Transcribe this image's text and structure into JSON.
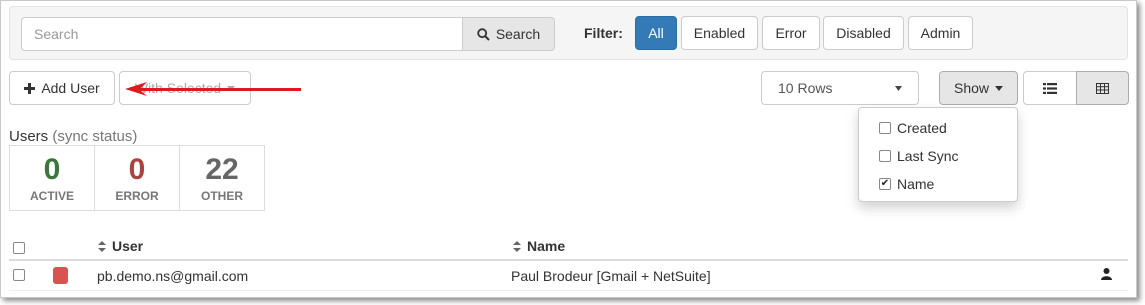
{
  "search": {
    "placeholder": "Search",
    "button_label": "Search",
    "button_icon": "search-icon"
  },
  "filter": {
    "label": "Filter:",
    "buttons": [
      {
        "label": "All",
        "active": true
      },
      {
        "label": "Enabled",
        "active": false
      },
      {
        "label": "Error",
        "active": false
      },
      {
        "label": "Disabled",
        "active": false
      },
      {
        "label": "Admin",
        "active": false
      }
    ]
  },
  "toolbar": {
    "add_user_label": "Add User",
    "with_selected_label": "With Selected",
    "rows_select_value": "10 Rows",
    "show_label": "Show",
    "view_list_icon": "list-icon",
    "view_grid_icon": "grid-icon"
  },
  "show_menu": {
    "items": [
      {
        "label": "Created",
        "checked": false
      },
      {
        "label": "Last Sync",
        "checked": false
      },
      {
        "label": "Name",
        "checked": true
      }
    ]
  },
  "users_summary": {
    "title": "Users",
    "subtitle": "(sync status)",
    "stats": [
      {
        "value": "0",
        "label": "ACTIVE",
        "color": "#3c763d"
      },
      {
        "value": "0",
        "label": "ERROR",
        "color": "#a94442"
      },
      {
        "value": "22",
        "label": "OTHER",
        "color": "#666666"
      }
    ]
  },
  "table": {
    "columns": {
      "user": "User",
      "name": "Name"
    },
    "rows": [
      {
        "user": "pb.demo.ns@gmail.com",
        "name": "Paul Brodeur [Gmail + NetSuite]",
        "status_color": "#d9534f",
        "role_icon": "user-icon"
      }
    ]
  },
  "colors": {
    "primary": "#337ab7",
    "annotation_arrow": "#e0191c"
  }
}
